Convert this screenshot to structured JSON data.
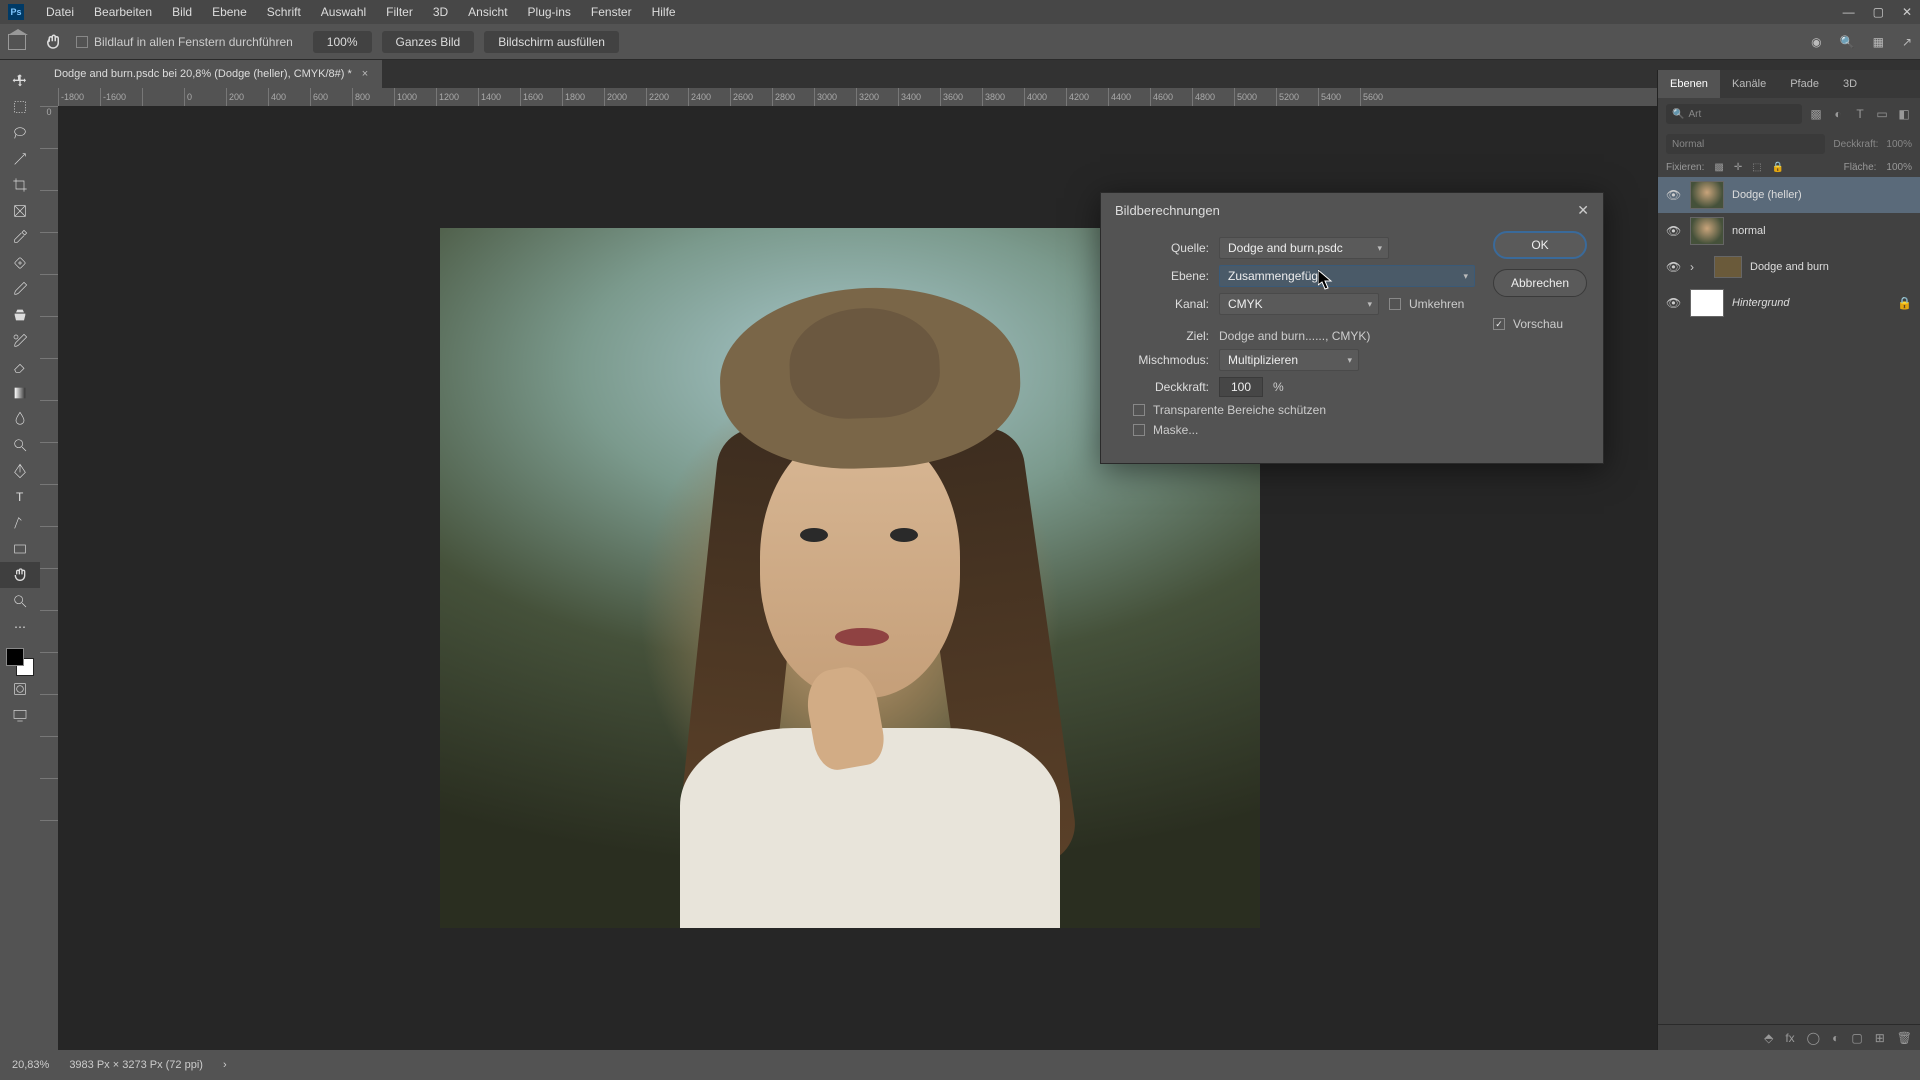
{
  "menubar": {
    "logo": "Ps",
    "items": [
      "Datei",
      "Bearbeiten",
      "Bild",
      "Ebene",
      "Schrift",
      "Auswahl",
      "Filter",
      "3D",
      "Ansicht",
      "Plug-ins",
      "Fenster",
      "Hilfe"
    ]
  },
  "optionsbar": {
    "scroll_all": "Bildlauf in allen Fenstern durchführen",
    "zoom100": "100%",
    "fit_screen": "Ganzes Bild",
    "fill_screen": "Bildschirm ausfüllen"
  },
  "doctab": {
    "title": "Dodge and burn.psdc bei 20,8% (Dodge (heller), CMYK/8#) *"
  },
  "ruler": {
    "h": [
      "-1800",
      "-1600",
      "",
      "0",
      "200",
      "400",
      "600",
      "800",
      "1000",
      "1200",
      "1400",
      "1600",
      "1800",
      "2000",
      "2200",
      "2400",
      "2600",
      "2800",
      "3000",
      "3200",
      "3400",
      "3600",
      "3800",
      "4000",
      "4200",
      "4400",
      "4600",
      "4800",
      "5000",
      "5200",
      "5400",
      "5600"
    ],
    "v": [
      "0",
      "",
      "",
      "",
      "",
      "",
      "",
      "",
      "",
      "",
      "",
      "",
      "",
      "",
      "",
      "",
      "",
      ""
    ]
  },
  "dialog": {
    "title": "Bildberechnungen",
    "source_label": "Quelle:",
    "source_value": "Dodge and burn.psdc",
    "layer_label": "Ebene:",
    "layer_value": "Zusammengefügt",
    "channel_label": "Kanal:",
    "channel_value": "CMYK",
    "invert": "Umkehren",
    "target_label": "Ziel:",
    "target_value": "Dodge and burn......, CMYK)",
    "blend_label": "Mischmodus:",
    "blend_value": "Multiplizieren",
    "opacity_label": "Deckkraft:",
    "opacity_value": "100",
    "opacity_unit": "%",
    "transparent": "Transparente Bereiche schützen",
    "mask": "Maske...",
    "ok": "OK",
    "cancel": "Abbrechen",
    "preview": "Vorschau"
  },
  "panels": {
    "tabs": [
      "Ebenen",
      "Kanäle",
      "Pfade",
      "3D"
    ],
    "search_placeholder": "Art",
    "blend_mode": "Normal",
    "opacity_label": "Deckkraft:",
    "opacity_value": "100%",
    "lock_label": "Fixieren:",
    "fill_label": "Fläche:",
    "fill_value": "100%",
    "layers": [
      {
        "name": "Dodge (heller)",
        "selected": true,
        "visible": true,
        "thumb": "img"
      },
      {
        "name": "normal",
        "selected": false,
        "visible": true,
        "thumb": "img"
      },
      {
        "name": "Dodge and burn",
        "selected": false,
        "visible": true,
        "thumb": "folder"
      },
      {
        "name": "Hintergrund",
        "selected": false,
        "visible": true,
        "thumb": "white",
        "locked": true,
        "italic": true
      }
    ]
  },
  "status": {
    "zoom": "20,83%",
    "info": "3983 Px × 3273 Px (72 ppi)"
  }
}
